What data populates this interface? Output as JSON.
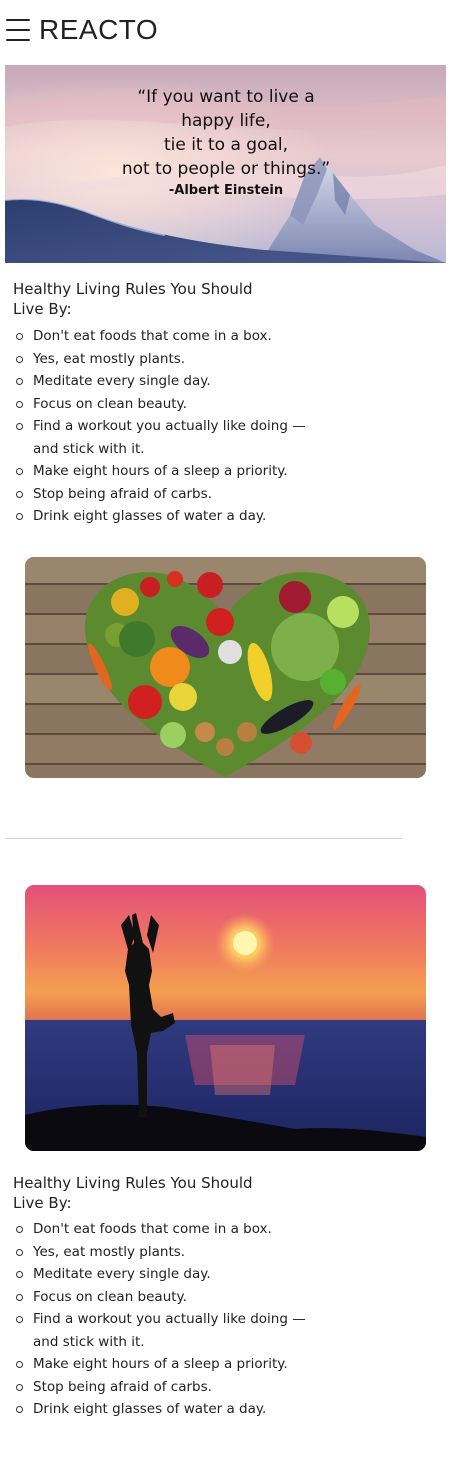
{
  "header": {
    "menu_icon": "hamburger-menu-icon",
    "brand": "REACTO"
  },
  "hero": {
    "quote": "“If you want to live a\nhappy life,\ntie it to a goal,\nnot to people or things.”",
    "author": "-Albert Einstein"
  },
  "section1": {
    "title": "Healthy Living Rules You Should Live By:",
    "rules": [
      "Don't eat foods that come in a box.",
      "Yes, eat mostly plants.",
      "Meditate every single day.",
      "Focus on clean beauty.",
      "Find a workout you actually like doing —and stick with it.",
      "Make eight hours of a sleep a priority.",
      "Stop being afraid of carbs.",
      "Drink eight glasses of water a day."
    ]
  },
  "section2": {
    "title": "Healthy Living Rules You Should Live By:",
    "rules": [
      "Don't eat foods that come in a box.",
      "Yes, eat mostly plants.",
      "Meditate every single day.",
      "Focus on clean beauty.",
      "Find a workout you actually like doing —and stick with it.",
      "Make eight hours of a sleep a priority.",
      "Stop being afraid of carbs.",
      "Drink eight glasses of water a day."
    ]
  },
  "images": {
    "veggie": "vegetable-heart-photo",
    "yoga": "yoga-sunset-photo"
  }
}
